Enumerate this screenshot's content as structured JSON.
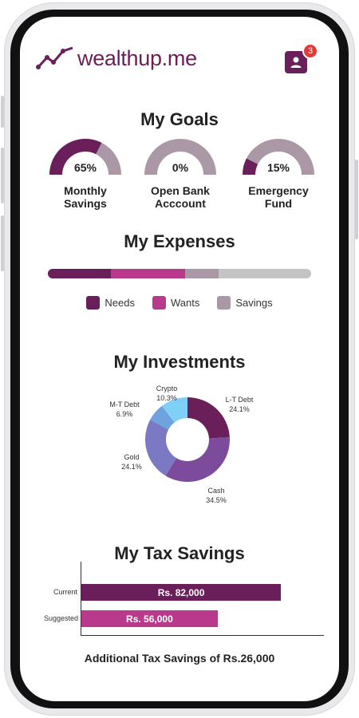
{
  "app": {
    "brand": "wealthup.me",
    "notification_count": "3",
    "colors": {
      "primary": "#6b1f5a",
      "accent": "#b93a8d",
      "muted": "#ab98a6",
      "track": "#c4c4c4",
      "badge": "#e53935"
    }
  },
  "goals": {
    "title": "My Goals",
    "items": [
      {
        "label_line1": "Monthly",
        "label_line2": "Savings",
        "percent_label": "65%",
        "progress": 0.65
      },
      {
        "label_line1": "Open Bank",
        "label_line2": "Acccount",
        "percent_label": "0%",
        "progress": 0.0
      },
      {
        "label_line1": "Emergency",
        "label_line2": "Fund",
        "percent_label": "15%",
        "progress": 0.15
      }
    ]
  },
  "expenses": {
    "title": "My Expenses",
    "segments": [
      {
        "name": "Needs",
        "fraction": 0.24,
        "color": "#6b1f5a"
      },
      {
        "name": "Wants",
        "fraction": 0.28,
        "color": "#b93a8d"
      },
      {
        "name": "Savings",
        "fraction": 0.13,
        "color": "#ab98a6"
      }
    ],
    "legend": [
      "Needs",
      "Wants",
      "Savings"
    ]
  },
  "investments": {
    "title": "My Investments"
  },
  "tax": {
    "title": "My Tax Savings",
    "summary": "Additional Tax Savings of Rs.26,000"
  },
  "chart_data": [
    {
      "type": "pie",
      "title": "My Investments",
      "slices": [
        {
          "label": "L-T Debt",
          "value": 24.1,
          "value_label": "24.1%",
          "color": "#6b1f5a"
        },
        {
          "label": "Cash",
          "value": 34.5,
          "value_label": "34.5%",
          "color": "#7d4b9b"
        },
        {
          "label": "Gold",
          "value": 24.1,
          "value_label": "24.1%",
          "color": "#7b78c4"
        },
        {
          "label": "M-T Debt",
          "value": 6.9,
          "value_label": "6.9%",
          "color": "#6ea3e0"
        },
        {
          "label": "Crypto",
          "value": 10.3,
          "value_label": "10.3%",
          "color": "#7fd0f7"
        }
      ]
    },
    {
      "type": "bar",
      "title": "My Tax Savings",
      "orientation": "horizontal",
      "categories": [
        "Current",
        "Suggested"
      ],
      "values": [
        82000,
        56000
      ],
      "value_labels": [
        "Rs. 82,000",
        "Rs. 56,000"
      ],
      "colors": [
        "#6b1f5a",
        "#b93a8d"
      ],
      "xlim": [
        0,
        100000
      ]
    }
  ]
}
